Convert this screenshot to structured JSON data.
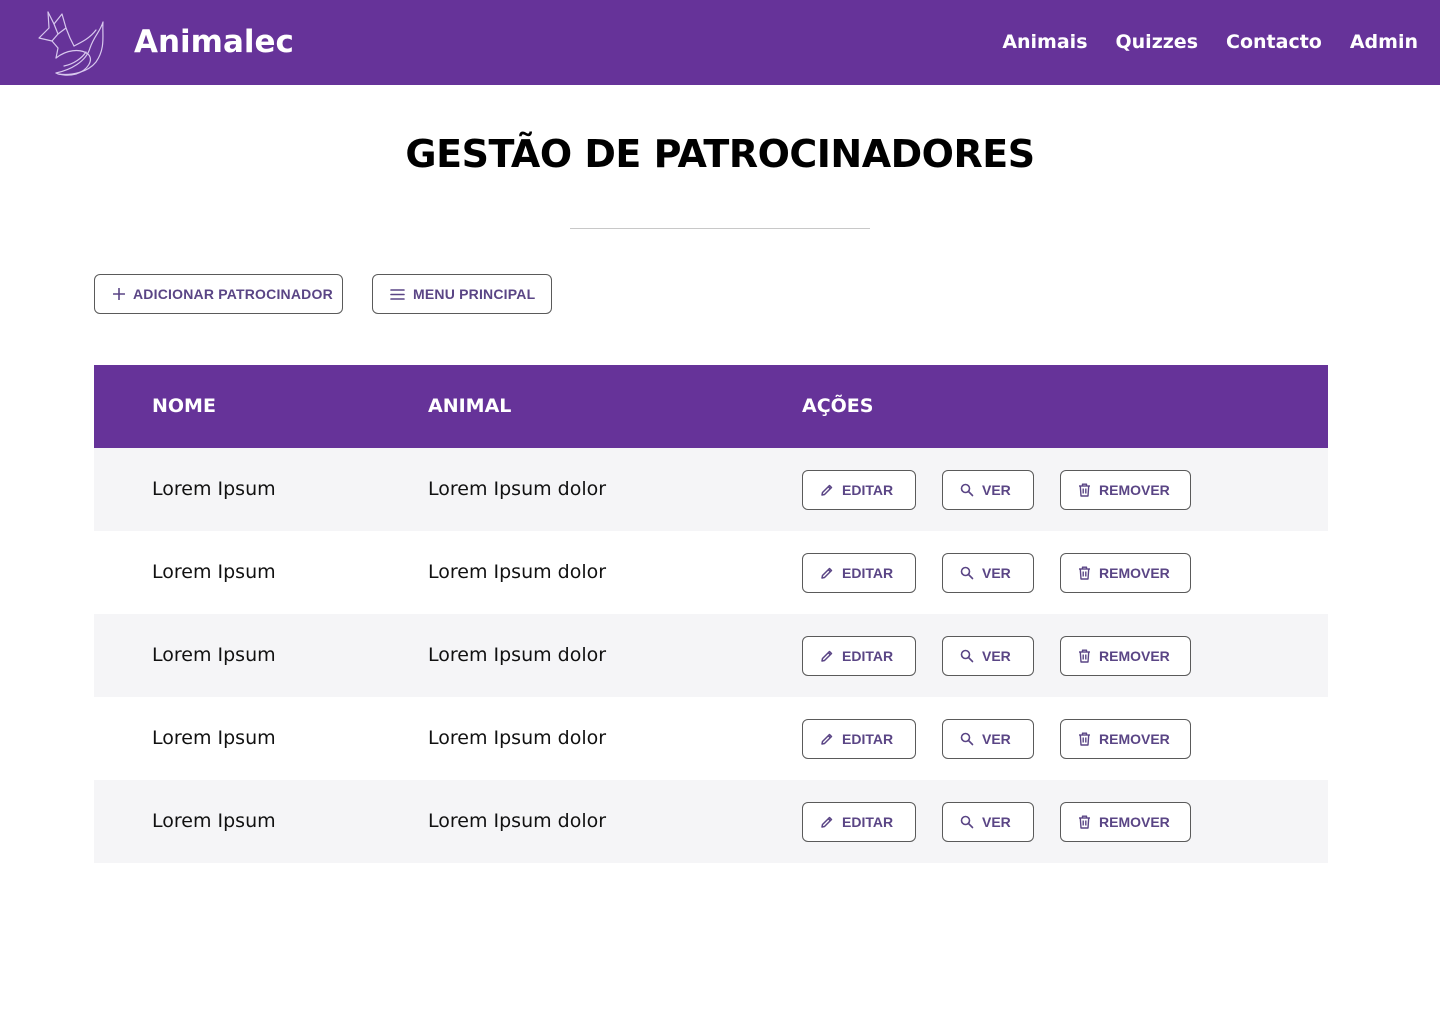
{
  "header": {
    "brand": "Animalec",
    "logo_icon": "fox-icon",
    "nav": [
      "Animais",
      "Quizzes",
      "Contacto",
      "Admin"
    ]
  },
  "page": {
    "title": "GESTÃO DE PATROCINADORES"
  },
  "actions": {
    "add_label": "ADICIONAR PATROCINADOR",
    "add_icon": "plus-icon",
    "menu_label": "MENU PRINCIPAL",
    "menu_icon": "menu-icon"
  },
  "table": {
    "columns": [
      "NOME",
      "ANIMAL",
      "AÇÕES"
    ],
    "rows": [
      {
        "nome": "Lorem Ipsum",
        "animal": "Lorem Ipsum dolor"
      },
      {
        "nome": "Lorem Ipsum",
        "animal": "Lorem Ipsum dolor"
      },
      {
        "nome": "Lorem Ipsum",
        "animal": "Lorem Ipsum dolor"
      },
      {
        "nome": "Lorem Ipsum",
        "animal": "Lorem Ipsum dolor"
      },
      {
        "nome": "Lorem Ipsum",
        "animal": "Lorem Ipsum dolor"
      }
    ],
    "row_actions": {
      "edit": "EDITAR",
      "edit_icon": "pencil-icon",
      "view": "VER",
      "view_icon": "search-icon",
      "remove": "REMOVER",
      "remove_icon": "trash-icon"
    }
  },
  "colors": {
    "primary": "#663399",
    "button_text": "#5a4585",
    "row_alt": "#f5f5f7"
  }
}
